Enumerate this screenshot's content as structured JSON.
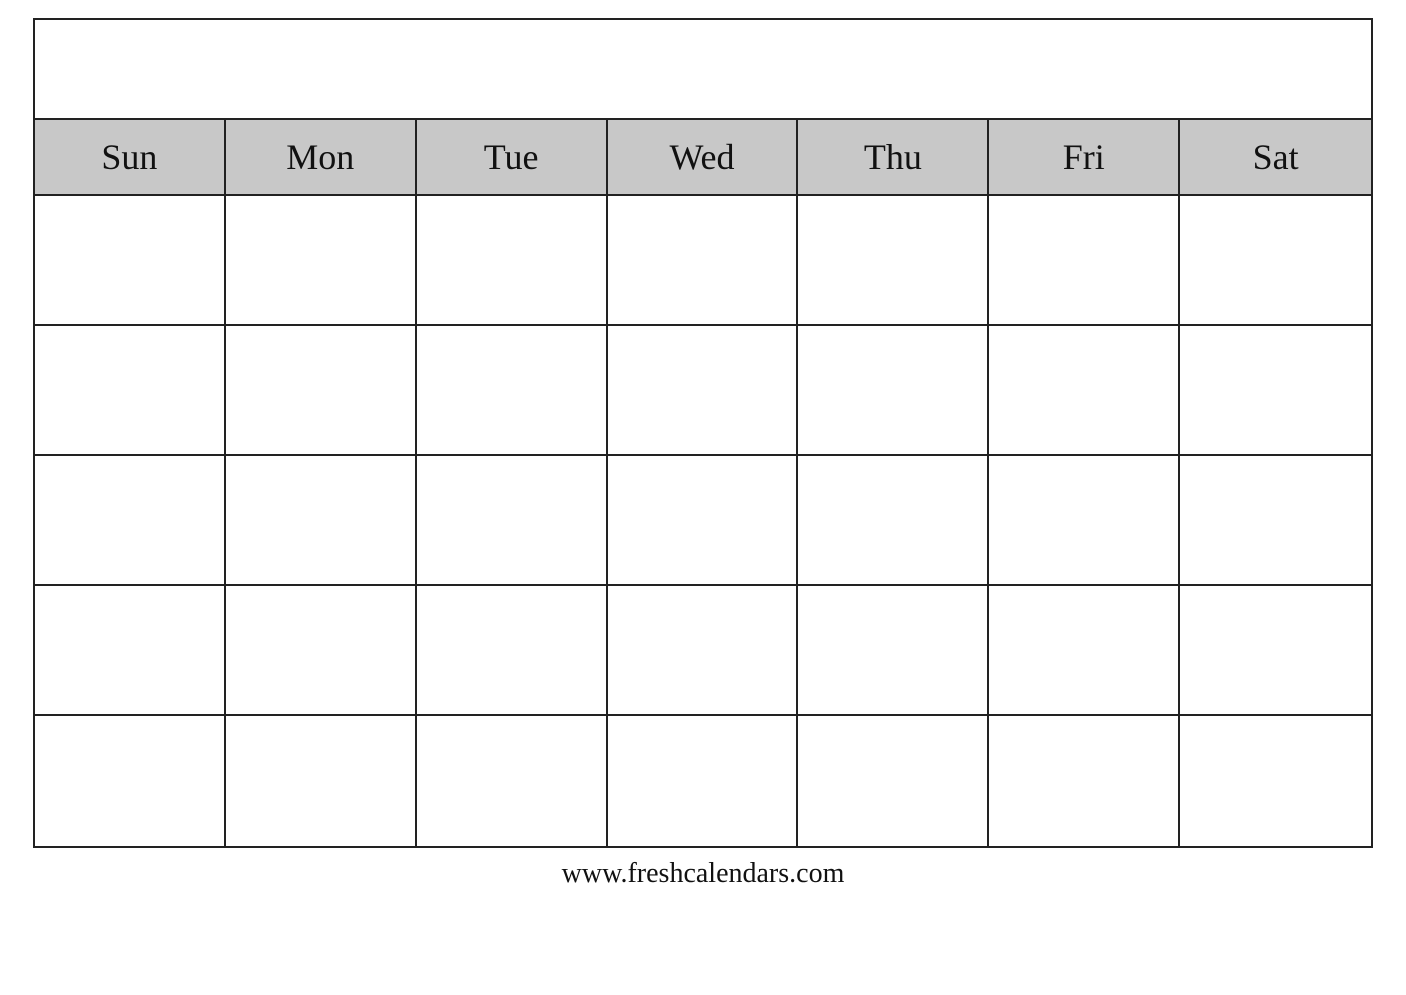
{
  "calendar": {
    "title": "",
    "days": [
      "Sun",
      "Mon",
      "Tue",
      "Wed",
      "Thu",
      "Fri",
      "Sat"
    ],
    "rows": 5,
    "footer": "www.freshcalendars.com"
  }
}
